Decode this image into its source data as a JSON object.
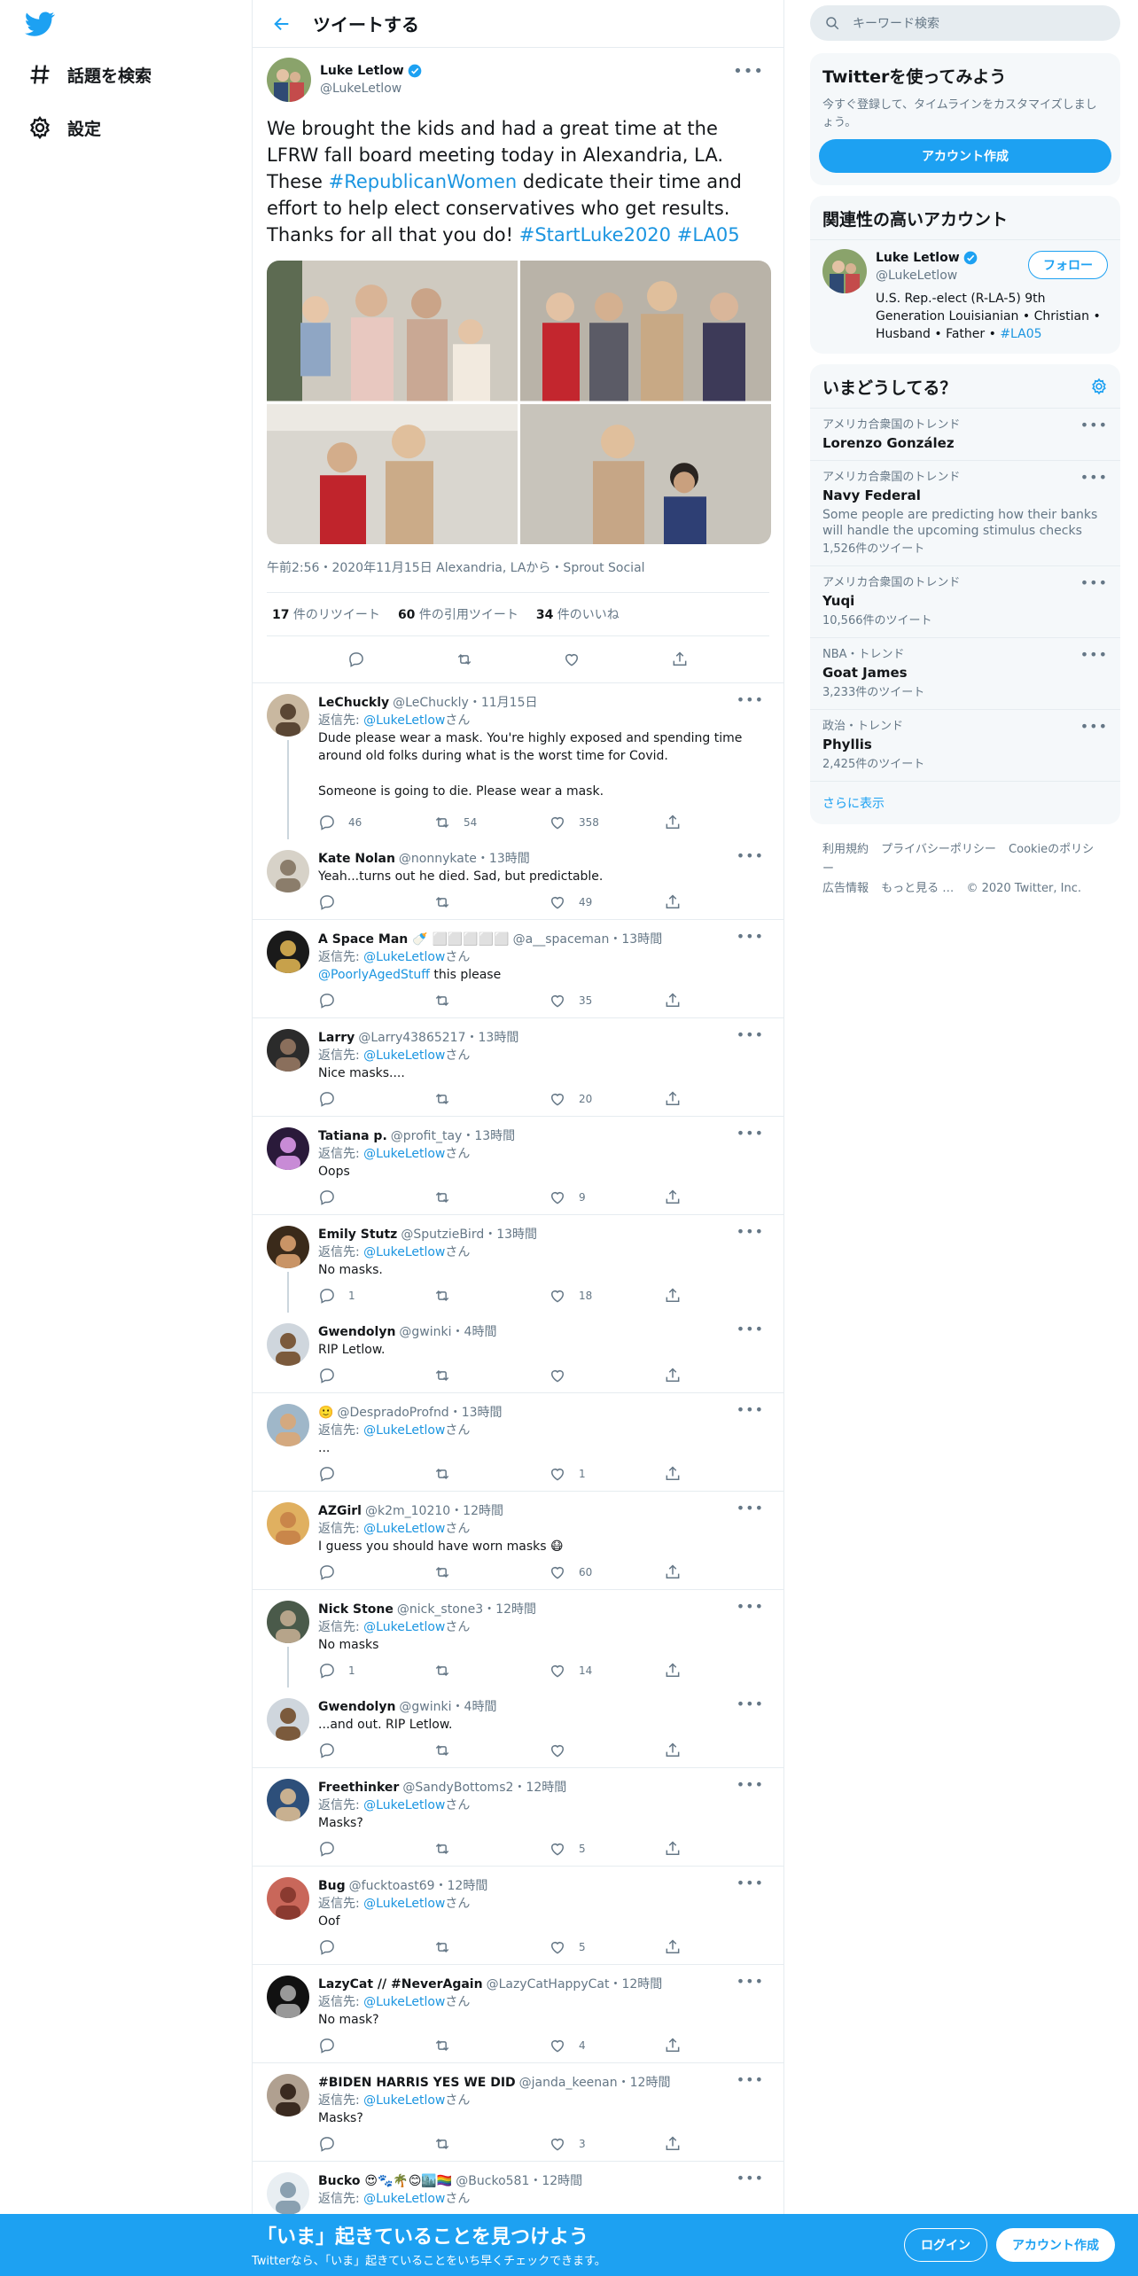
{
  "nav": {
    "explore_label": "話題を検索",
    "settings_label": "設定"
  },
  "header": {
    "title": "ツイートする"
  },
  "focal": {
    "name": "Luke Letlow",
    "handle": "@LukeLetlow",
    "text_1": "We brought the kids and had a great time at the LFRW fall board meeting today in Alexandria, LA. These ",
    "hashtag_1": "#RepublicanWomen",
    "text_2": " dedicate their time and effort to help elect conservatives who get results. Thanks for all that you do! ",
    "hashtag_2": "#StartLuke2020",
    "hashtag_3": "#LA05",
    "meta": "午前2:56・2020年11月15日 Alexandria, LAから・Sprout Social",
    "retweets_count": "17",
    "retweets_label": " 件のリツイート",
    "quotes_count": "60",
    "quotes_label": " 件の引用ツイート",
    "likes_count": "34",
    "likes_label": " 件のいいね"
  },
  "reply_prefix": "返信先: ",
  "reply_suffix": "さん",
  "replies": [
    {
      "name": "LeChuckly",
      "handle": "@LeChuckly",
      "time": "・11月15日",
      "reply_to": "@LukeLetlow",
      "text": "Dude please wear a mask. You're highly exposed and spending time around old folks during what is the worst time for Covid.\n\nSomeone is going to die. Please wear a mask.",
      "replies": "46",
      "retweets": "54",
      "likes": "358"
    },
    {
      "name": "Kate Nolan",
      "handle": "@nonnykate",
      "time": "・13時間",
      "reply_to": "",
      "text": "Yeah...turns out he died. Sad, but predictable.",
      "replies": "",
      "retweets": "",
      "likes": "49"
    },
    {
      "name": "A Space Man 🍼 ⬜⬜⬜⬜⬜",
      "handle": "@a__spaceman",
      "time": "・13時間",
      "reply_to": "@LukeLetlow",
      "mention": "@PoorlyAgedStuff",
      "text": " this please",
      "replies": "",
      "retweets": "",
      "likes": "35"
    },
    {
      "name": "Larry",
      "handle": "@Larry43865217",
      "time": "・13時間",
      "reply_to": "@LukeLetlow",
      "text": "Nice masks....",
      "replies": "",
      "retweets": "",
      "likes": "20"
    },
    {
      "name": "Tatiana p.",
      "handle": "@profit_tay",
      "time": "・13時間",
      "reply_to": "@LukeLetlow",
      "text": "Oops",
      "replies": "",
      "retweets": "",
      "likes": "9"
    },
    {
      "name": "Emily Stutz",
      "handle": "@SputzieBird",
      "time": "・13時間",
      "reply_to": "@LukeLetlow",
      "text": "No masks.",
      "replies": "1",
      "retweets": "",
      "likes": "18"
    },
    {
      "name": "Gwendolyn",
      "handle": "@gwinki",
      "time": "・4時間",
      "reply_to": "",
      "text": "RIP Letlow.",
      "replies": "",
      "retweets": "",
      "likes": ""
    },
    {
      "name": "🙂",
      "handle": "@DespradoProfnd",
      "time": "・13時間",
      "reply_to": "@LukeLetlow",
      "text": "...",
      "replies": "",
      "retweets": "",
      "likes": "1"
    },
    {
      "name": "AZGirl",
      "handle": "@k2m_10210",
      "time": "・12時間",
      "reply_to": "@LukeLetlow",
      "text": "I guess you should have worn masks 😷",
      "replies": "",
      "retweets": "",
      "likes": "60"
    },
    {
      "name": "Nick Stone",
      "handle": "@nick_stone3",
      "time": "・12時間",
      "reply_to": "@LukeLetlow",
      "text": "No masks",
      "replies": "1",
      "retweets": "",
      "likes": "14"
    },
    {
      "name": "Gwendolyn",
      "handle": "@gwinki",
      "time": "・4時間",
      "reply_to": "",
      "text": "...and out. RIP Letlow.",
      "replies": "",
      "retweets": "",
      "likes": ""
    },
    {
      "name": "Freethinker",
      "handle": "@SandyBottoms2",
      "time": "・12時間",
      "reply_to": "@LukeLetlow",
      "text": "Masks?",
      "replies": "",
      "retweets": "",
      "likes": "5"
    },
    {
      "name": "Bug",
      "handle": "@fucktoast69",
      "time": "・12時間",
      "reply_to": "@LukeLetlow",
      "text": "Oof",
      "replies": "",
      "retweets": "",
      "likes": "5"
    },
    {
      "name": "LazyCat // #NeverAgain",
      "handle": "@LazyCatHappyCat",
      "time": "・12時間",
      "reply_to": "@LukeLetlow",
      "text": "No mask?",
      "replies": "",
      "retweets": "",
      "likes": "4"
    },
    {
      "name": "#BIDEN HARRIS YES WE DID",
      "handle": "@janda_keenan",
      "time": "・12時間",
      "reply_to": "@LukeLetlow",
      "text": "Masks?",
      "replies": "",
      "retweets": "",
      "likes": "3"
    },
    {
      "name": "Bucko 😍🐾🌴😊🏙️🏳️‍🌈",
      "handle": "@Bucko581",
      "time": "・12時間",
      "reply_to": "@LukeLetlow",
      "text": "",
      "replies": "",
      "retweets": "",
      "likes": ""
    }
  ],
  "right": {
    "search_placeholder": "キーワード検索",
    "signup_title": "Twitterを使ってみよう",
    "signup_desc": "今すぐ登録して、タイムラインをカスタマイズしましょう。",
    "signup_button": "アカウント作成",
    "related_title": "関連性の高いアカウント",
    "related_name": "Luke Letlow",
    "related_handle": "@LukeLetlow",
    "related_bio": "U.S. Rep.-elect (R-LA-5) 9th Generation Louisianian • Christian • Husband • Father • ",
    "related_bio_tag": "#LA05",
    "follow_button": "フォロー",
    "trends_title": "いまどうしてる？",
    "trends": [
      {
        "category": "アメリカ合衆国のトレンド",
        "name": "Lorenzo González",
        "desc": "",
        "count": ""
      },
      {
        "category": "アメリカ合衆国のトレンド",
        "name": "Navy Federal",
        "desc": "Some people are predicting how their banks will handle the upcoming stimulus checks",
        "count": "1,526件のツイート"
      },
      {
        "category": "アメリカ合衆国のトレンド",
        "name": "Yuqi",
        "desc": "",
        "count": "10,566件のツイート"
      },
      {
        "category": "NBA・トレンド",
        "name": "Goat James",
        "desc": "",
        "count": "3,233件のツイート"
      },
      {
        "category": "政治・トレンド",
        "name": "Phyllis",
        "desc": "",
        "count": "2,425件のツイート"
      }
    ],
    "show_more": "さらに表示",
    "footer_links": [
      "利用規約",
      "プライバシーポリシー",
      "Cookieのポリシー",
      "広告情報",
      "もっと見る …"
    ],
    "copyright": "© 2020 Twitter, Inc."
  },
  "bottombar": {
    "title": "「いま」起きていることを見つけよう",
    "subtitle": "Twitterなら、「いま」起きていることをいち早くチェックできます。",
    "login": "ログイン",
    "signup": "アカウント作成"
  },
  "colors": {
    "accent": "#1da1f2",
    "link": "#1b95e0",
    "muted": "#657786",
    "border": "#e6ecf0"
  }
}
